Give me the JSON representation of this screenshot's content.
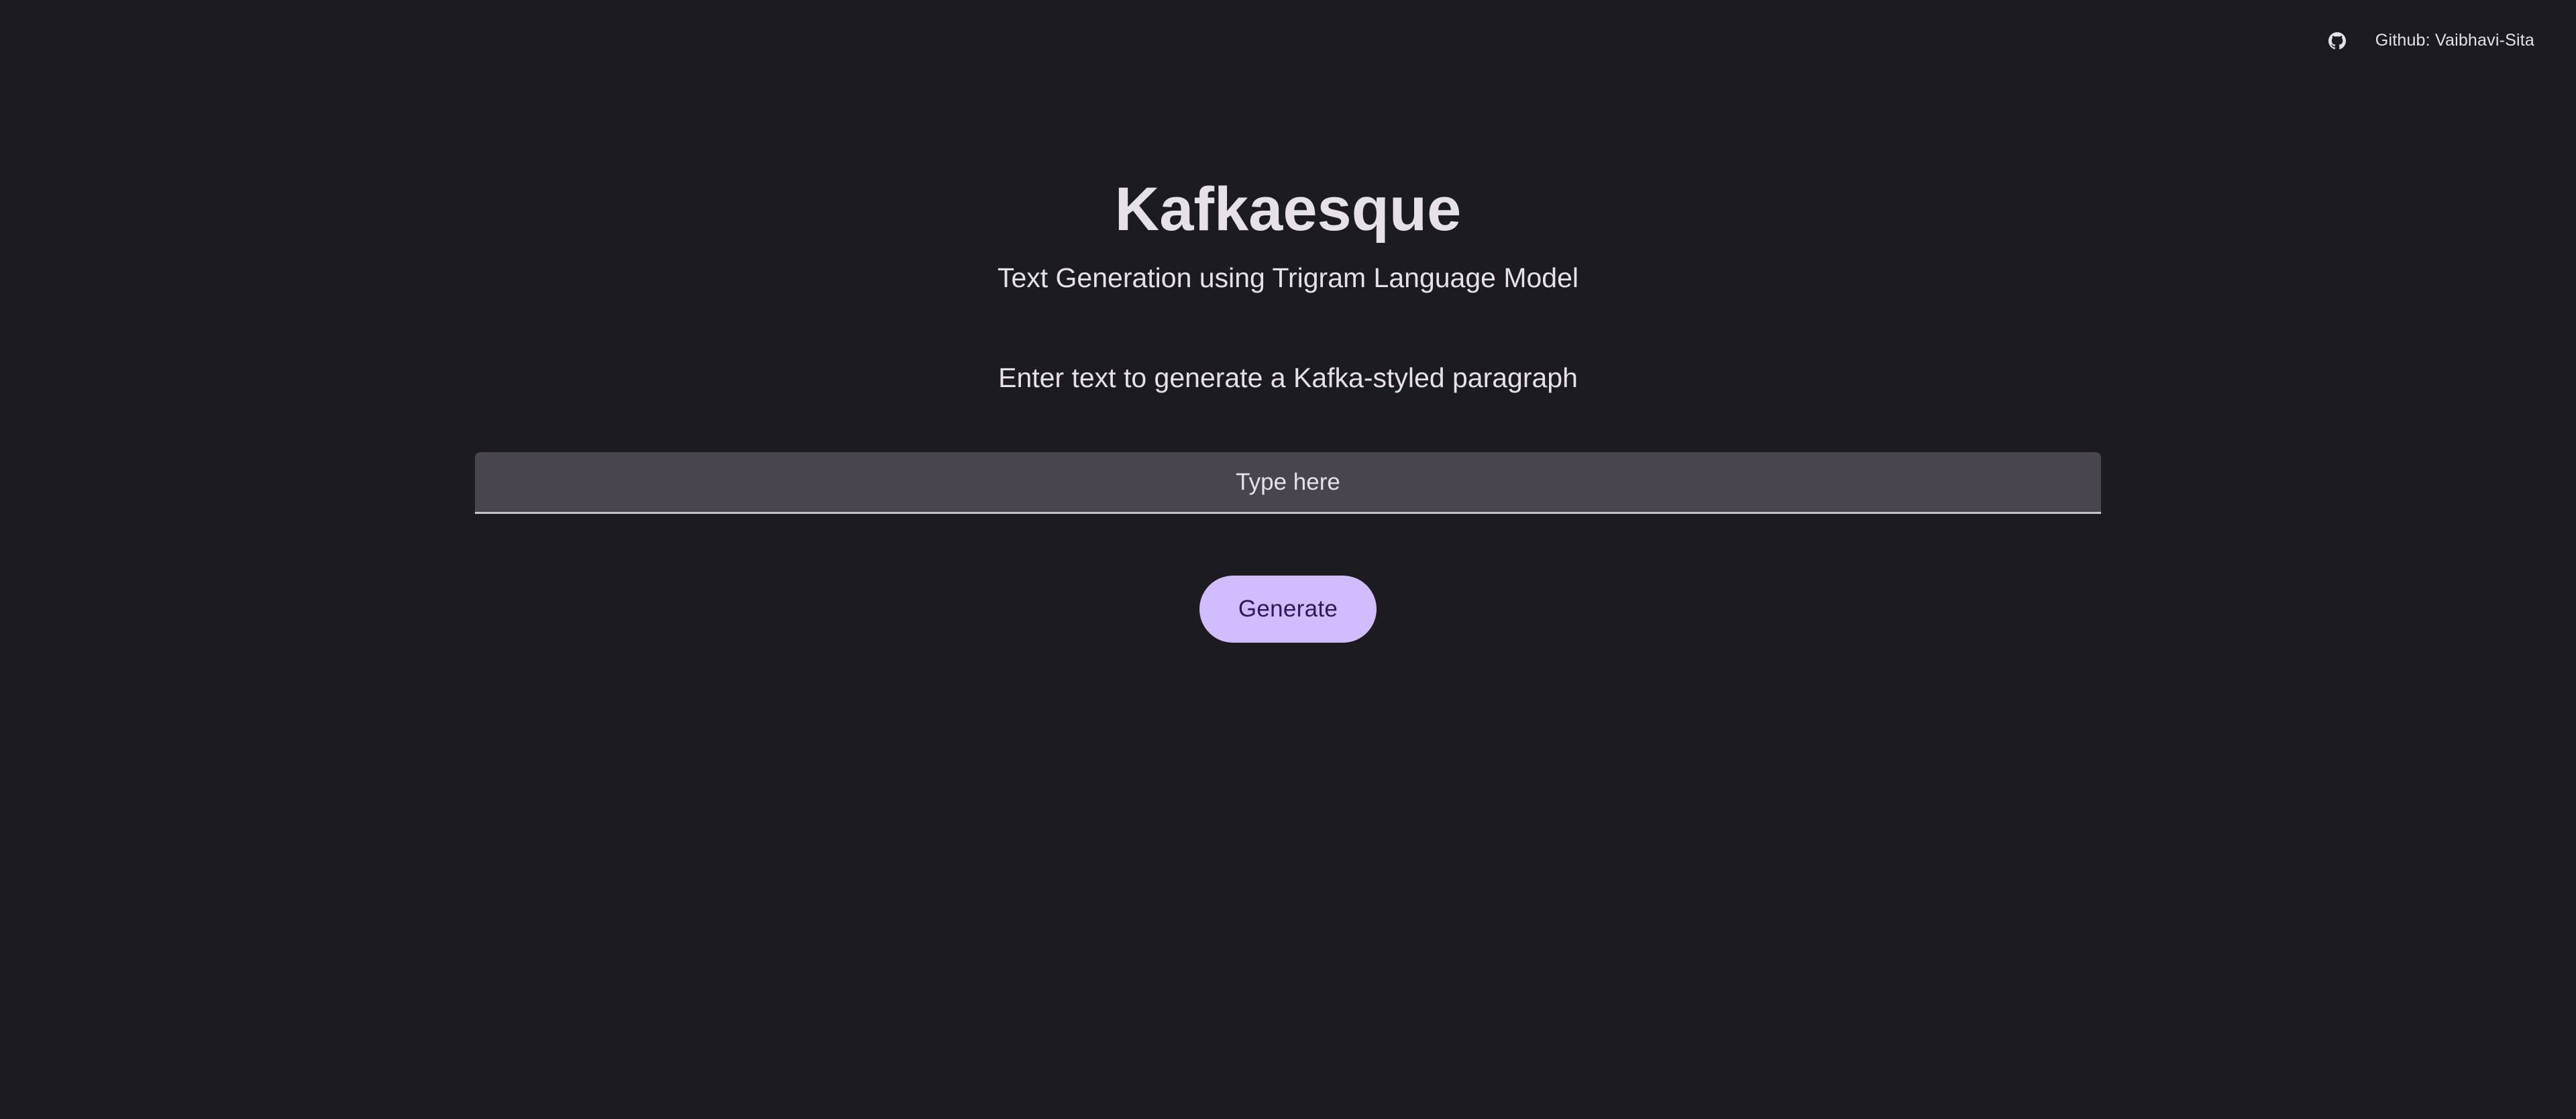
{
  "header": {
    "github_icon": "github-icon",
    "github_link": "Github: Vaibhavi-Sita"
  },
  "main": {
    "title": "Kafkaesque",
    "subtitle": "Text Generation using Trigram Language Model",
    "prompt": "Enter text to generate a Kafka-styled paragraph",
    "input": {
      "value": "",
      "placeholder": "Type here"
    },
    "generate_label": "Generate"
  },
  "colors": {
    "background": "#1c1b20",
    "text": "#e6e1e8",
    "input_bg": "#49454f",
    "button_bg": "#d0bcff",
    "button_text": "#2d1b55"
  }
}
